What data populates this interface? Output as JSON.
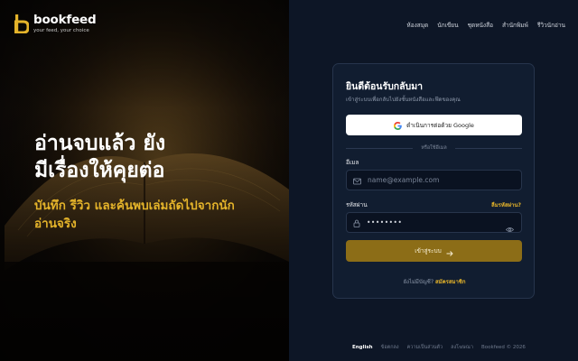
{
  "brand": {
    "name": "bookfeed",
    "tagline": "your feed, your choice",
    "color": "#e4b32a"
  },
  "hero": {
    "title_line1": "อ่านจบแล้ว ยัง",
    "title_line2": "มีเรื่องให้คุยต่อ",
    "subtitle_line1": "บันทึก รีวิว และค้นพบเล่มถัดไปจากนัก",
    "subtitle_line2": "อ่านจริง"
  },
  "nav": {
    "items": [
      "ห้องสมุด",
      "นักเขียน",
      "ชุดหนังสือ",
      "สำนักพิมพ์",
      "รีวิวนักอ่าน"
    ]
  },
  "login": {
    "title": "ยินดีต้อนรับกลับมา",
    "subtitle": "เข้าสู่ระบบเพื่อกลับไปยังชั้นหนังสือและฟีดของคุณ",
    "google_label": "ดำเนินการต่อด้วย Google",
    "divider": "หรือใช้อีเมล",
    "email_label": "อีเมล",
    "email_placeholder": "name@example.com",
    "password_label": "รหัสผ่าน",
    "forgot": "ลืมรหัสผ่าน?",
    "password_value": "••••••••",
    "submit": "เข้าสู่ระบบ",
    "no_account": "ยังไม่มีบัญชี?",
    "signup": "สมัครสมาชิก"
  },
  "footer": {
    "language": "English",
    "terms": "ข้อตกลง",
    "privacy": "ความเป็นส่วนตัว",
    "contact": "ลงโฆษณา",
    "copyright": "Bookfeed © 2026"
  },
  "icons": {
    "logo": "bookfeed-b-logo",
    "google": "google-icon",
    "mail": "mail-icon",
    "lock": "lock-icon",
    "eye": "eye-icon",
    "arrow": "arrow-right-icon"
  }
}
